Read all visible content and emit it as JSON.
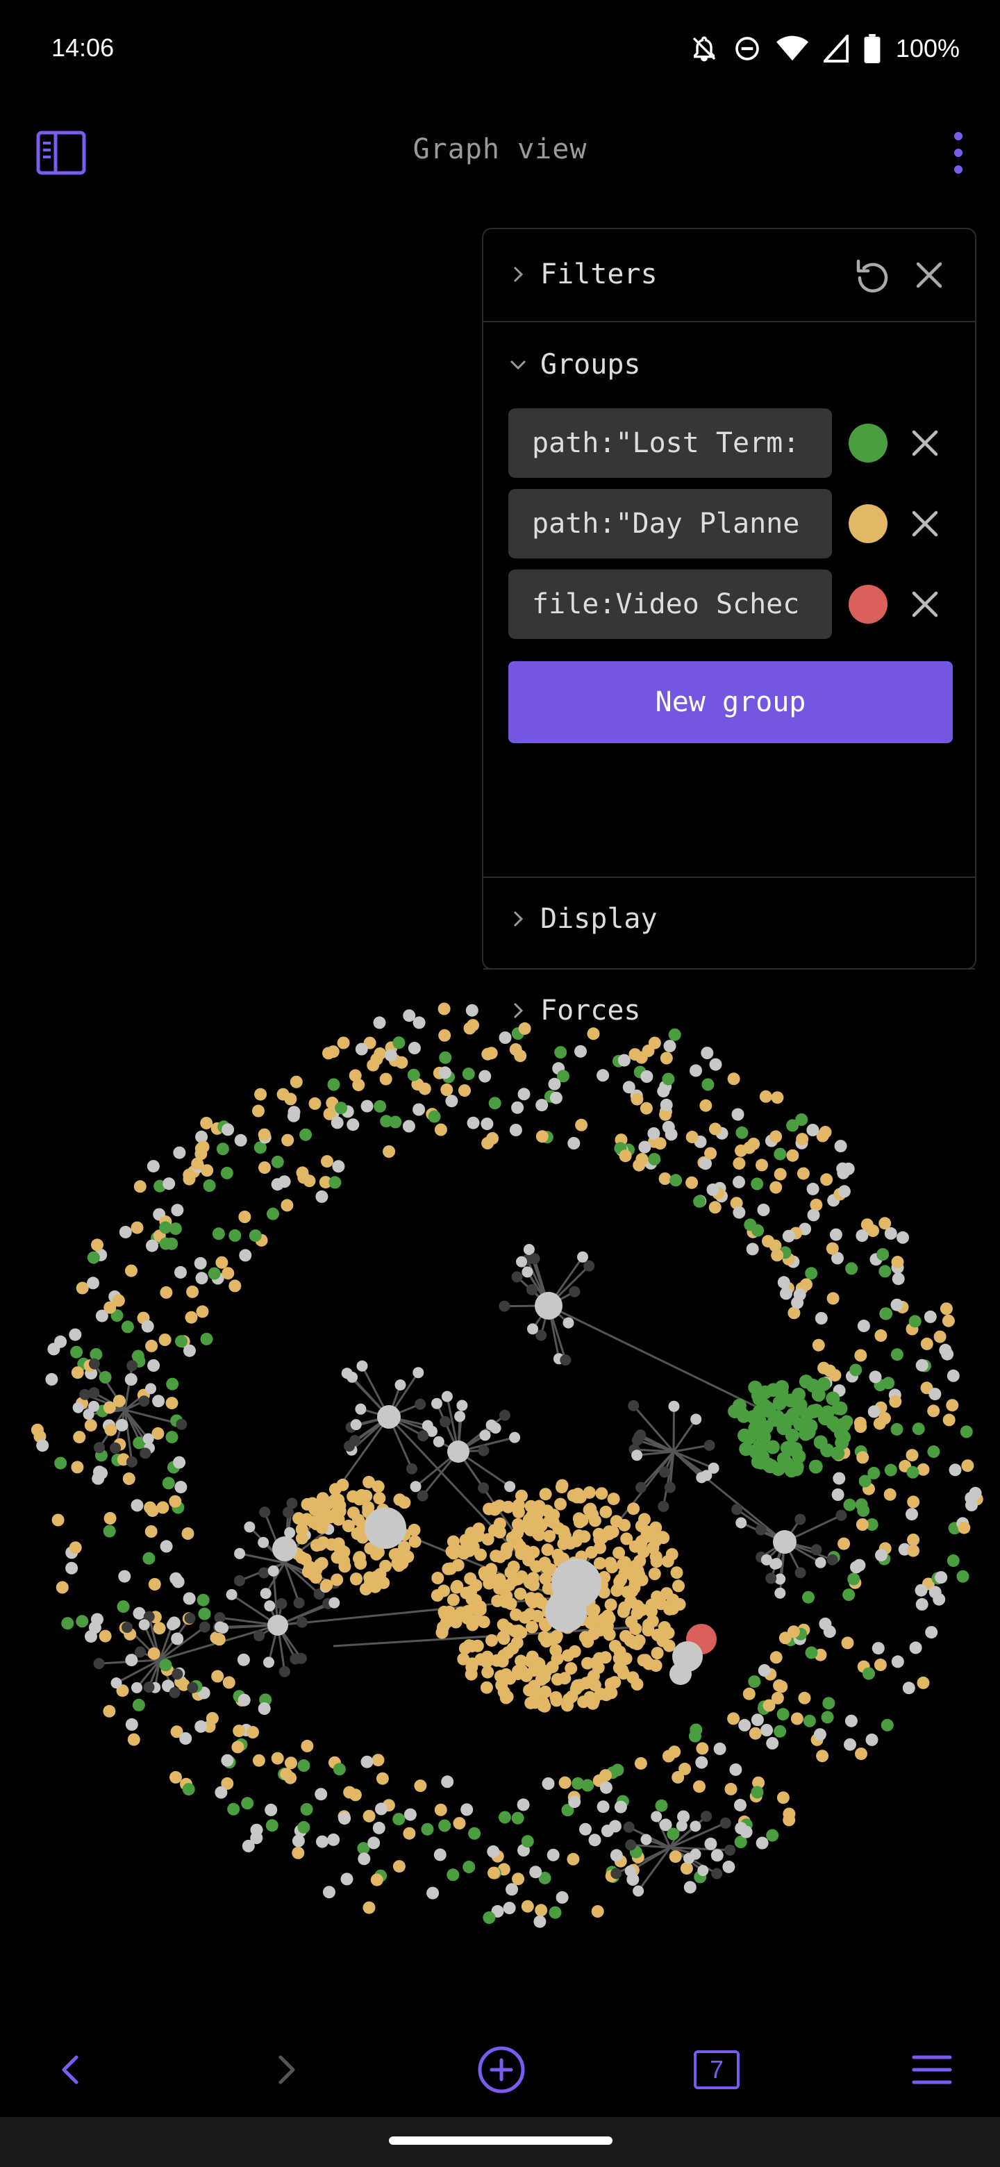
{
  "status_bar": {
    "time": "14:06",
    "battery": "100%",
    "icons": [
      "notifications-off-icon",
      "do-not-disturb-icon",
      "wifi-icon",
      "signal-icon",
      "battery-icon"
    ]
  },
  "header": {
    "title": "Graph view",
    "left_icon": "sidebar-toggle-icon",
    "right_icon": "more-vertical-icon"
  },
  "panel": {
    "filters": {
      "label": "Filters",
      "expanded": false
    },
    "groups": {
      "label": "Groups",
      "expanded": true,
      "items": [
        {
          "query": "path:\"Lost Term:",
          "color": "#4b9e3f"
        },
        {
          "query": "path:\"Day Planne",
          "color": "#e2b866"
        },
        {
          "query": "file:Video Schec",
          "color": "#d9605b"
        }
      ],
      "new_group_label": "New group"
    },
    "display": {
      "label": "Display",
      "expanded": false
    },
    "forces": {
      "label": "Forces",
      "expanded": false
    }
  },
  "graph": {
    "node_colors": {
      "default": "#c8c8c8",
      "dim": "#3c3c3c",
      "green": "#4b9e3f",
      "yellow": "#e2b866",
      "red": "#d9605b"
    },
    "edge_color": "#555555"
  },
  "bottom_nav": {
    "back_icon": "chevron-left-icon",
    "forward_icon": "chevron-right-icon",
    "new_note_icon": "plus-circle-icon",
    "tabs_count": "7",
    "menu_icon": "hamburger-menu-icon"
  },
  "colors": {
    "accent": "#7b5cf0",
    "button": "#7456e0",
    "background": "#000000"
  }
}
